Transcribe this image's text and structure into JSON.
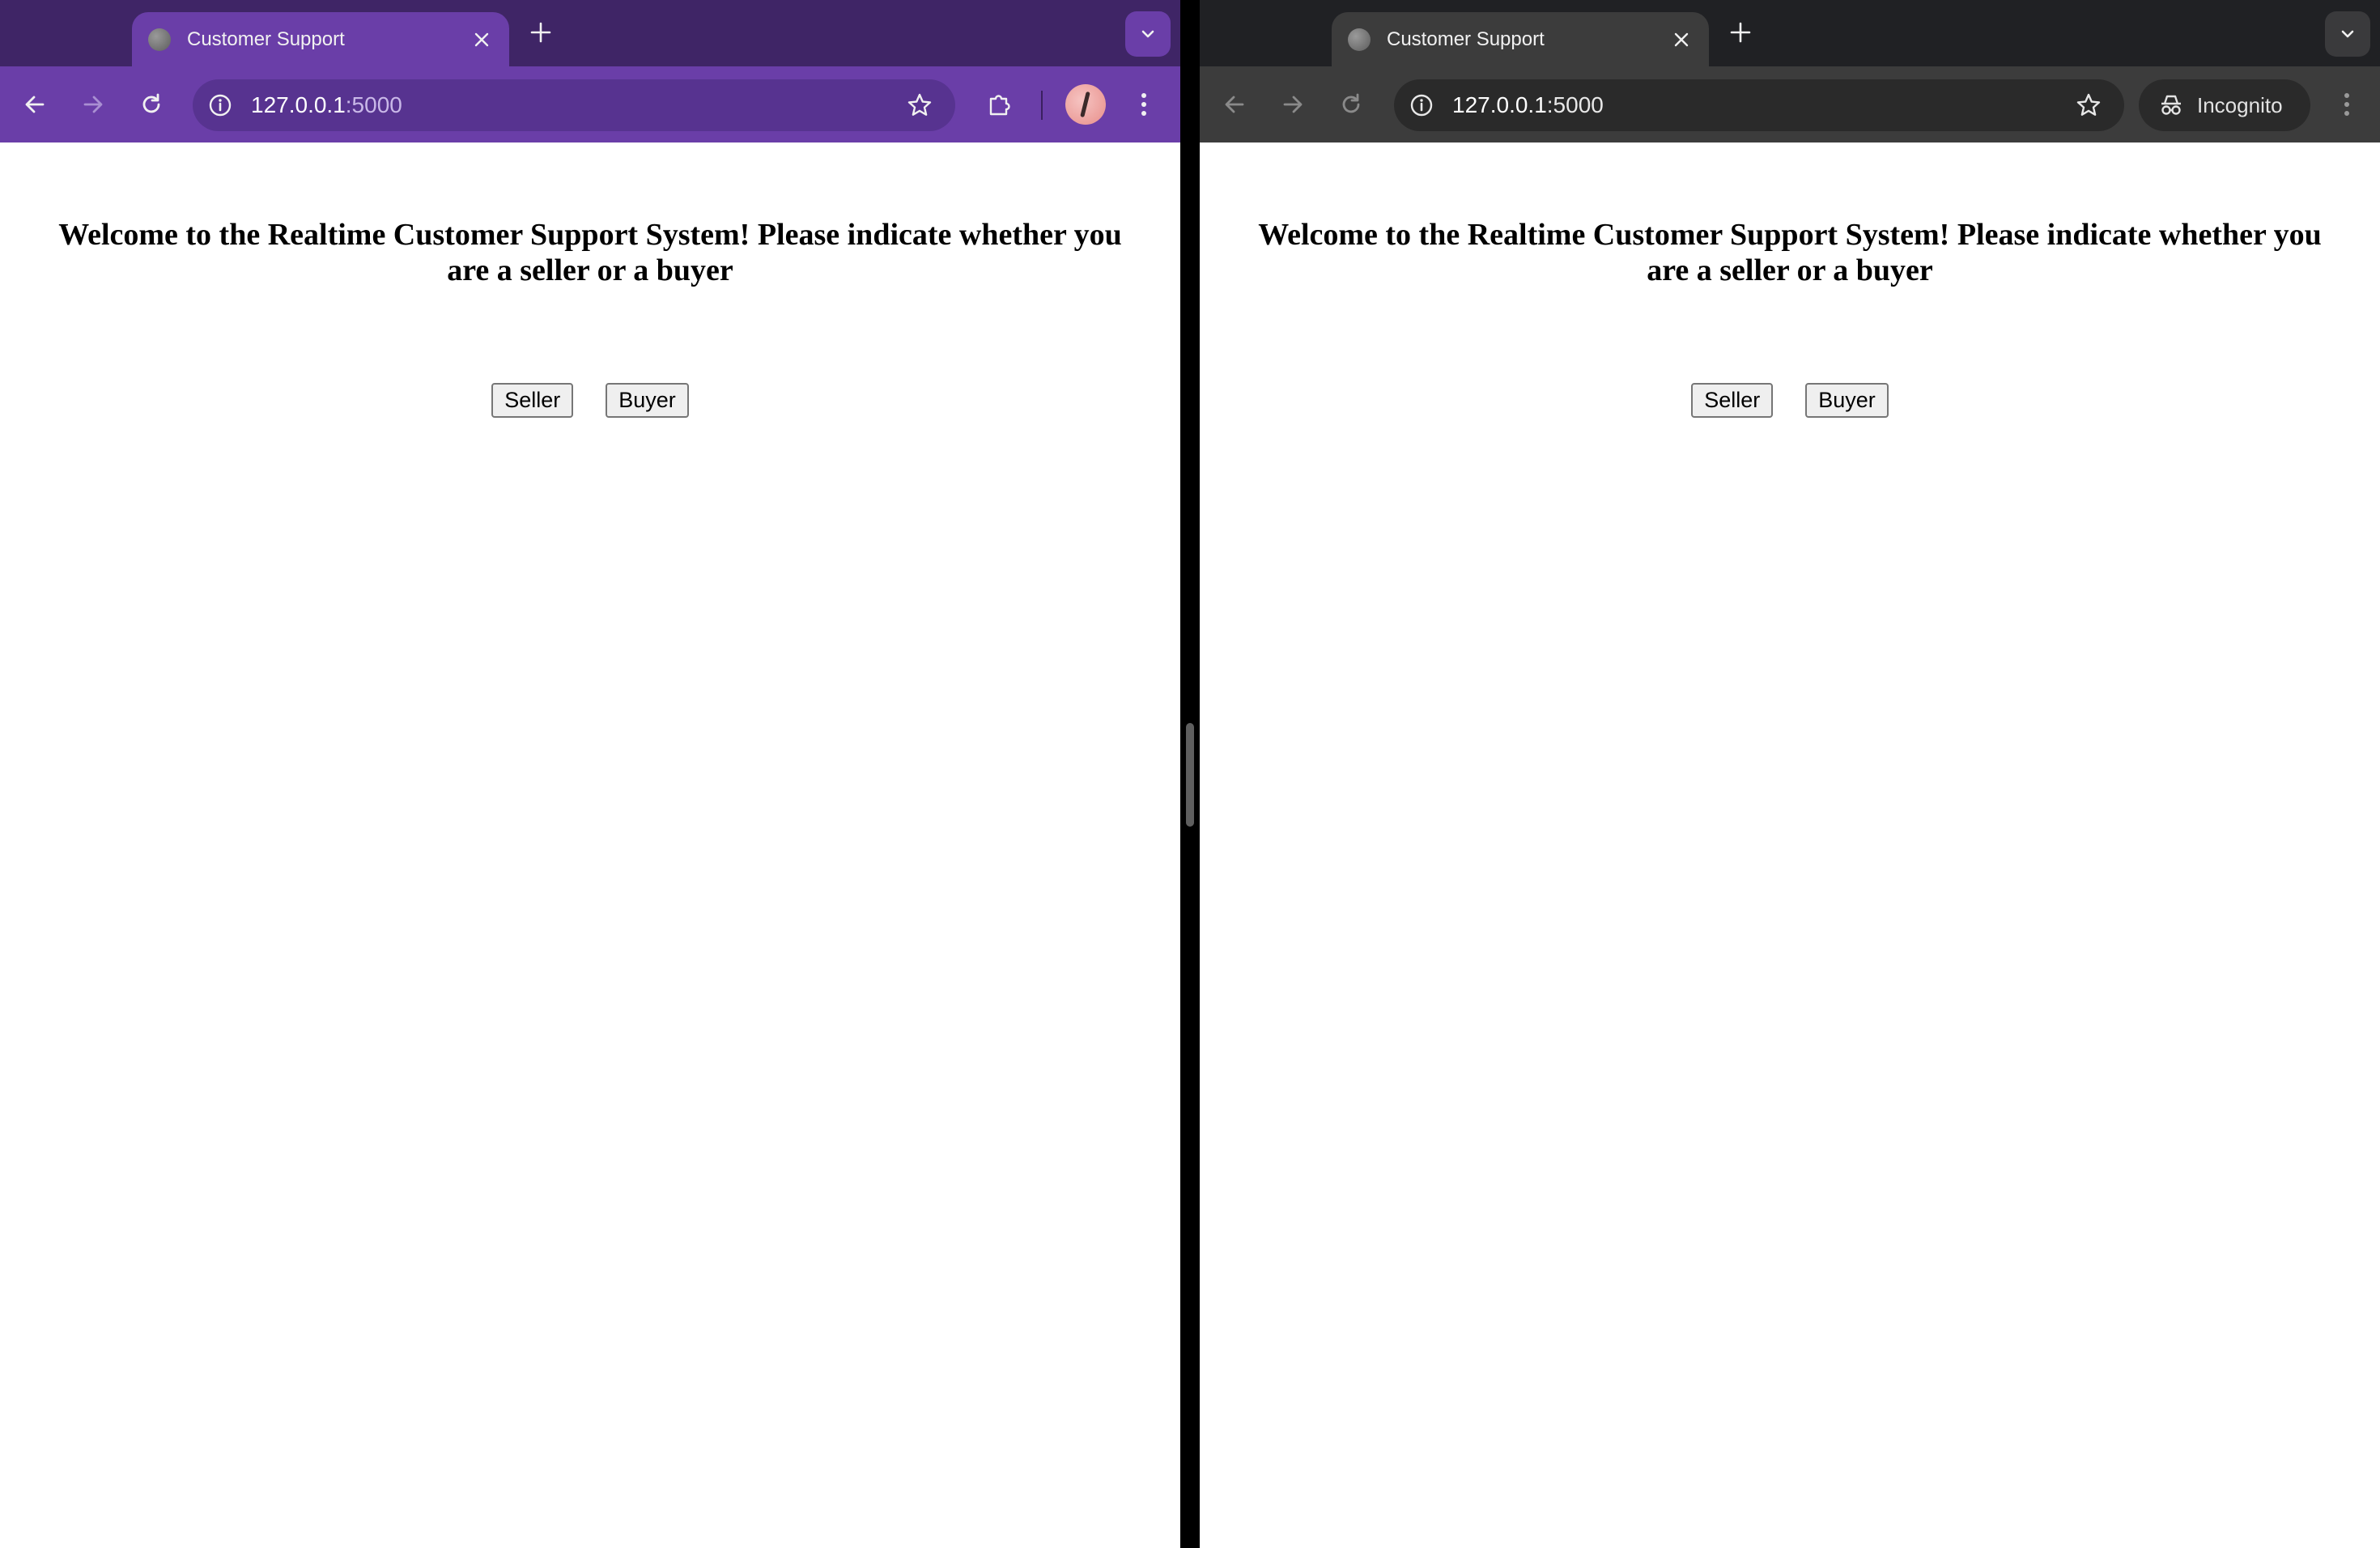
{
  "left_window": {
    "tab": {
      "title": "Customer Support",
      "favicon": "globe-icon"
    },
    "toolbar": {
      "url_host": "127.0.0.1",
      "url_port": ":5000"
    },
    "page": {
      "heading": "Welcome to the Realtime Customer Support System! Please indicate whether you are a seller or a buyer",
      "seller_label": "Seller",
      "buyer_label": "Buyer"
    },
    "theme": {
      "tabstrip": "#3f2566",
      "toolbar": "#6a3ea8",
      "omnibox": "#573390"
    }
  },
  "right_window": {
    "tab": {
      "title": "Customer Support",
      "favicon": "globe-icon"
    },
    "toolbar": {
      "url_host": "127.0.0.1",
      "url_port": ":5000",
      "incognito_label": "Incognito"
    },
    "page": {
      "heading": "Welcome to the Realtime Customer Support System! Please indicate whether you are a seller or a buyer",
      "seller_label": "Seller",
      "buyer_label": "Buyer"
    },
    "theme": {
      "tabstrip": "#202124",
      "toolbar": "#3c3c3c",
      "omnibox": "#2a2a2a"
    }
  }
}
